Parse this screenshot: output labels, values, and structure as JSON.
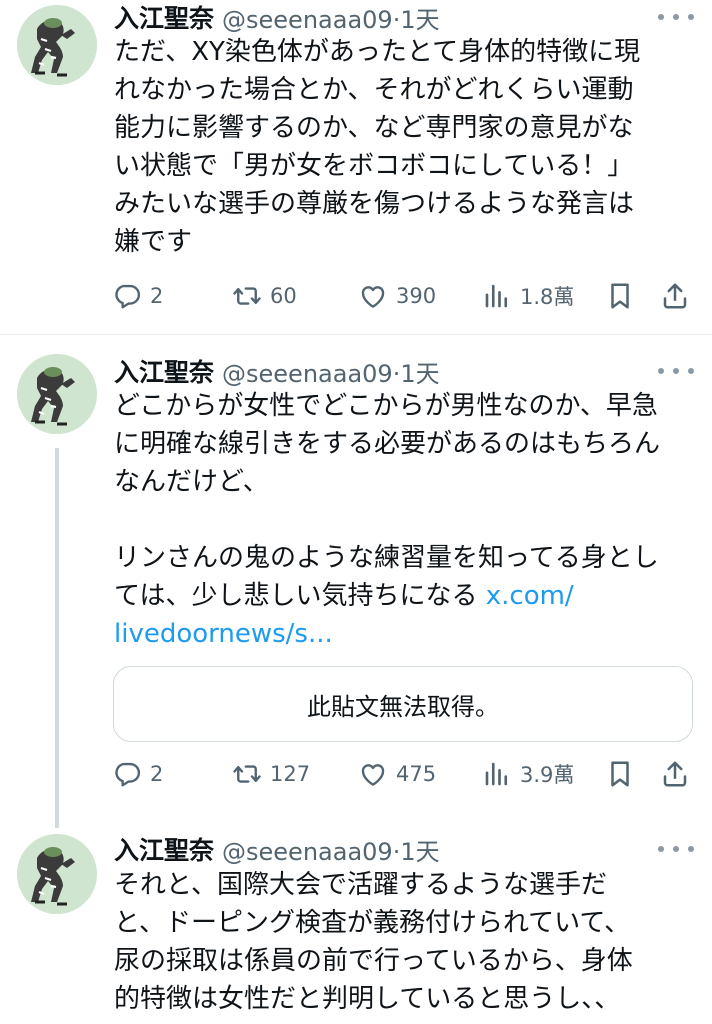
{
  "tweets": [
    {
      "author_name": "入江聖奈",
      "handle_time": "@seeenaaa09·1天",
      "text": "ただ、XY染色体があったとて身体的特徴に現\nれなかった場合とか、それがどれくらい運動\n能力に影響するのか、など専門家の意見がな\nい状態で「男が女をボコボコにしている！」\nみたいな選手の尊厳を傷つけるような発言は\n嫌です",
      "replies": "2",
      "retweets": "60",
      "likes": "390",
      "views": "1.8萬"
    },
    {
      "author_name": "入江聖奈",
      "handle_time": "@seeenaaa09·1天",
      "text": "どこからが女性でどこからが男性なのか、早急\nに明確な線引きをする必要があるのはもちろん\nなんだけど、\n\nリンさんの鬼のような練習量を知ってる身とし\nては、少し悲しい気持ちになる ",
      "link_text": "x.com/\nlivedoornews/s...",
      "quote_unavailable": "此貼文無法取得。",
      "replies": "2",
      "retweets": "127",
      "likes": "475",
      "views": "3.9萬"
    },
    {
      "author_name": "入江聖奈",
      "handle_time": "@seeenaaa09·1天",
      "text": "それと、国際大会で活躍するような選手だ\nと、ドーピング検査が義務付けられていて、\n尿の採取は係員の前で行っているから、身体\n的特徴は女性だと判明していると思うし、、"
    }
  ],
  "icons": {
    "reply": "reply-icon",
    "retweet": "retweet-icon",
    "like": "heart-icon",
    "views": "views-icon",
    "bookmark": "bookmark-icon",
    "share": "share-icon",
    "more": "more-icon"
  },
  "colors": {
    "text": "#0f1419",
    "secondary": "#536471",
    "link": "#1d9bf0",
    "border": "#cfd9de"
  }
}
